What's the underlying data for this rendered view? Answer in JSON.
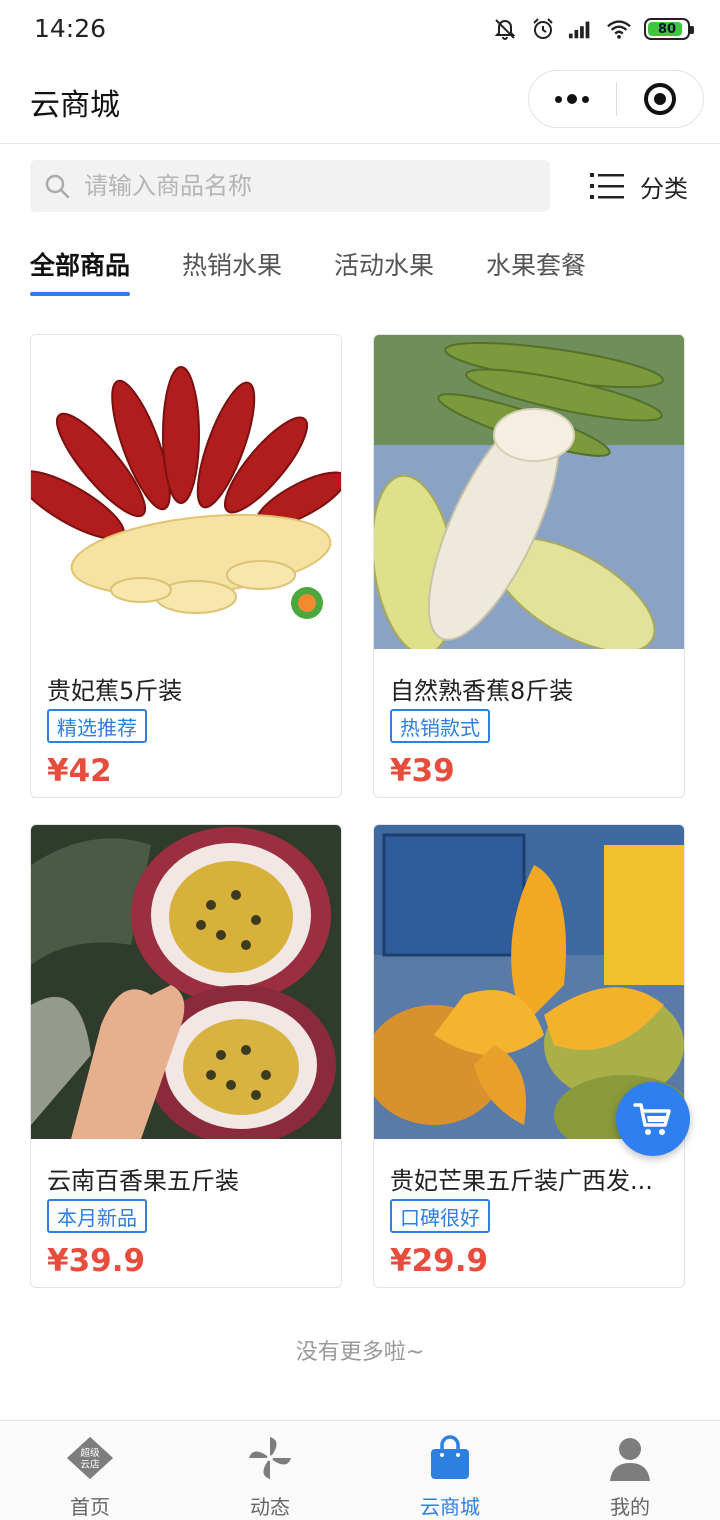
{
  "status_bar": {
    "time": "14:26",
    "battery": "80"
  },
  "nav": {
    "title": "云商城"
  },
  "search": {
    "placeholder": "请输入商品名称",
    "category_label": "分类"
  },
  "tabs": [
    {
      "label": "全部商品",
      "active": true
    },
    {
      "label": "热销水果",
      "active": false
    },
    {
      "label": "活动水果",
      "active": false
    },
    {
      "label": "水果套餐",
      "active": false
    }
  ],
  "products": [
    {
      "name": "贵妃蕉5斤装",
      "tag": "精选推荐",
      "price": "¥42"
    },
    {
      "name": "自然熟香蕉8斤装",
      "tag": "热销款式",
      "price": "¥39"
    },
    {
      "name": "云南百香果五斤装",
      "tag": "本月新品",
      "price": "¥39.9"
    },
    {
      "name": "贵妃芒果五斤装广西发...",
      "tag": "口碑很好",
      "price": "¥29.9"
    }
  ],
  "footer_note": "没有更多啦~",
  "tab_bar": {
    "items": [
      {
        "label": "首页",
        "icon": "home-store-icon",
        "badge_text_1": "超级",
        "badge_text_2": "云店"
      },
      {
        "label": "动态",
        "icon": "pinwheel-icon"
      },
      {
        "label": "云商城",
        "icon": "shopping-bag-icon",
        "active": true
      },
      {
        "label": "我的",
        "icon": "user-icon"
      }
    ]
  },
  "colors": {
    "accent": "#2d7fe0",
    "price": "#e84c3d",
    "fab": "#2f7ff0"
  }
}
